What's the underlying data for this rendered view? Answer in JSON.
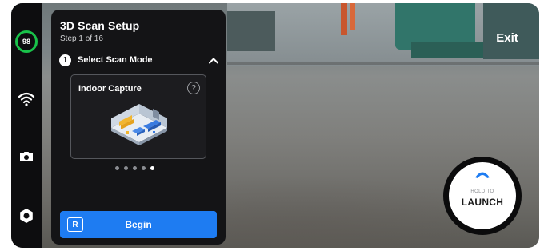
{
  "status": {
    "battery_level": "98",
    "battery_color": "#19c24a"
  },
  "sidebar": {
    "icons": [
      "wifi-icon",
      "camera-icon",
      "gear-icon"
    ]
  },
  "panel": {
    "title": "3D Scan Setup",
    "subtitle": "Step 1 of 16",
    "step": {
      "number": "1",
      "label": "Select Scan Mode"
    },
    "card": {
      "title": "Indoor Capture",
      "help_symbol": "?"
    },
    "pagination": {
      "count": 5,
      "active_index": 5
    },
    "begin_button": {
      "icon_letter": "R",
      "label": "Begin",
      "color": "#1e7cf2"
    }
  },
  "exit_label": "Exit",
  "launch_button": {
    "hint": "HOLD TO",
    "label": "LAUNCH",
    "accent": "#1e7cf2"
  }
}
